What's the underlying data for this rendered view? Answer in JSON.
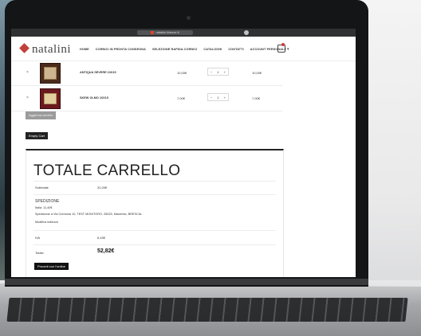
{
  "browser": {
    "url": "natalini-firenze.it"
  },
  "site": {
    "logo": "natalini",
    "nav": [
      "HOME",
      "CORNICI IN PRONTA CONSEGNA",
      "SELEZIONE RAPIDA CORNICI",
      "CATALOGHI",
      "CONTATTI",
      "ACCOUNT PERSONALE"
    ]
  },
  "cart": {
    "remove_symbol": "×",
    "minus": "−",
    "plus": "+",
    "items": [
      {
        "name": "ANTIQUA SEVERE 10X15",
        "price": "10,00€",
        "qty": "1",
        "subtotal": "10,00€"
      },
      {
        "name": "SKEW OLMO 10X15",
        "price": "7,00€",
        "qty": "1",
        "subtotal": "7,00€"
      }
    ],
    "update_button": "Aggiorna carrello",
    "empty_button": "Empty Cart"
  },
  "totals": {
    "title": "TOTALE CARRELLO",
    "subtotal_label": "Subtotale",
    "subtotal_value": "31,00€",
    "shipping_title": "SPEDIZIONE",
    "shipping_rate": "Italia: 11,40€",
    "shipping_address": "Spedizione a Via Cremona 10, TEST MONITORO, 25025, Manerbio, BRESCIA.",
    "shipping_change": "Modifica indirizzo",
    "tax_label": "IVA",
    "tax_value": "6,43€",
    "total_label": "Totale",
    "total_value": "52,82€",
    "checkout_button": "Procedi con l'ordine"
  }
}
